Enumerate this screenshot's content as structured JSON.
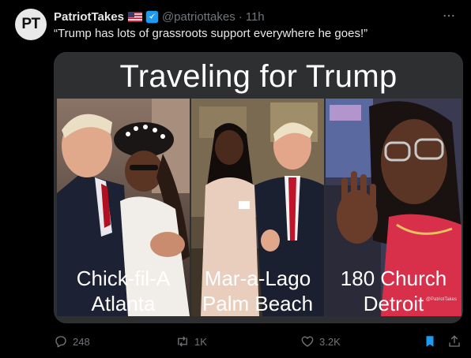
{
  "account": {
    "avatar_text": "PT",
    "name": "PatriotTakes",
    "handle": "@patriottakes",
    "separator": "·",
    "time": "11h"
  },
  "tweet": {
    "text": "“Trump has lots of grassroots support everywhere he goes!”"
  },
  "media": {
    "title": "Traveling for Trump",
    "panels": [
      {
        "line1": "Chick-fil-A",
        "line2": "Atlanta"
      },
      {
        "line1": "Mar-a-Lago",
        "line2": "Palm Beach"
      },
      {
        "line1": "180 Church",
        "line2": "Detroit"
      }
    ],
    "watermark": "@PatriotTakes"
  },
  "actions": {
    "replies": "248",
    "retweets": "1K",
    "likes": "3.2K"
  },
  "icons": {
    "more": "more-icon",
    "reply": "reply-icon",
    "retweet": "retweet-icon",
    "like": "heart-icon",
    "bookmark": "bookmark-icon",
    "share": "share-icon",
    "verified": "verified-badge-icon",
    "flag": "us-flag-icon"
  },
  "colors": {
    "background": "#000000",
    "text": "#e7e9ea",
    "muted": "#71767b",
    "verified_blue": "#1d9bf0",
    "bookmark_blue": "#1d9bf0",
    "card_bg": "#2e2f31"
  }
}
